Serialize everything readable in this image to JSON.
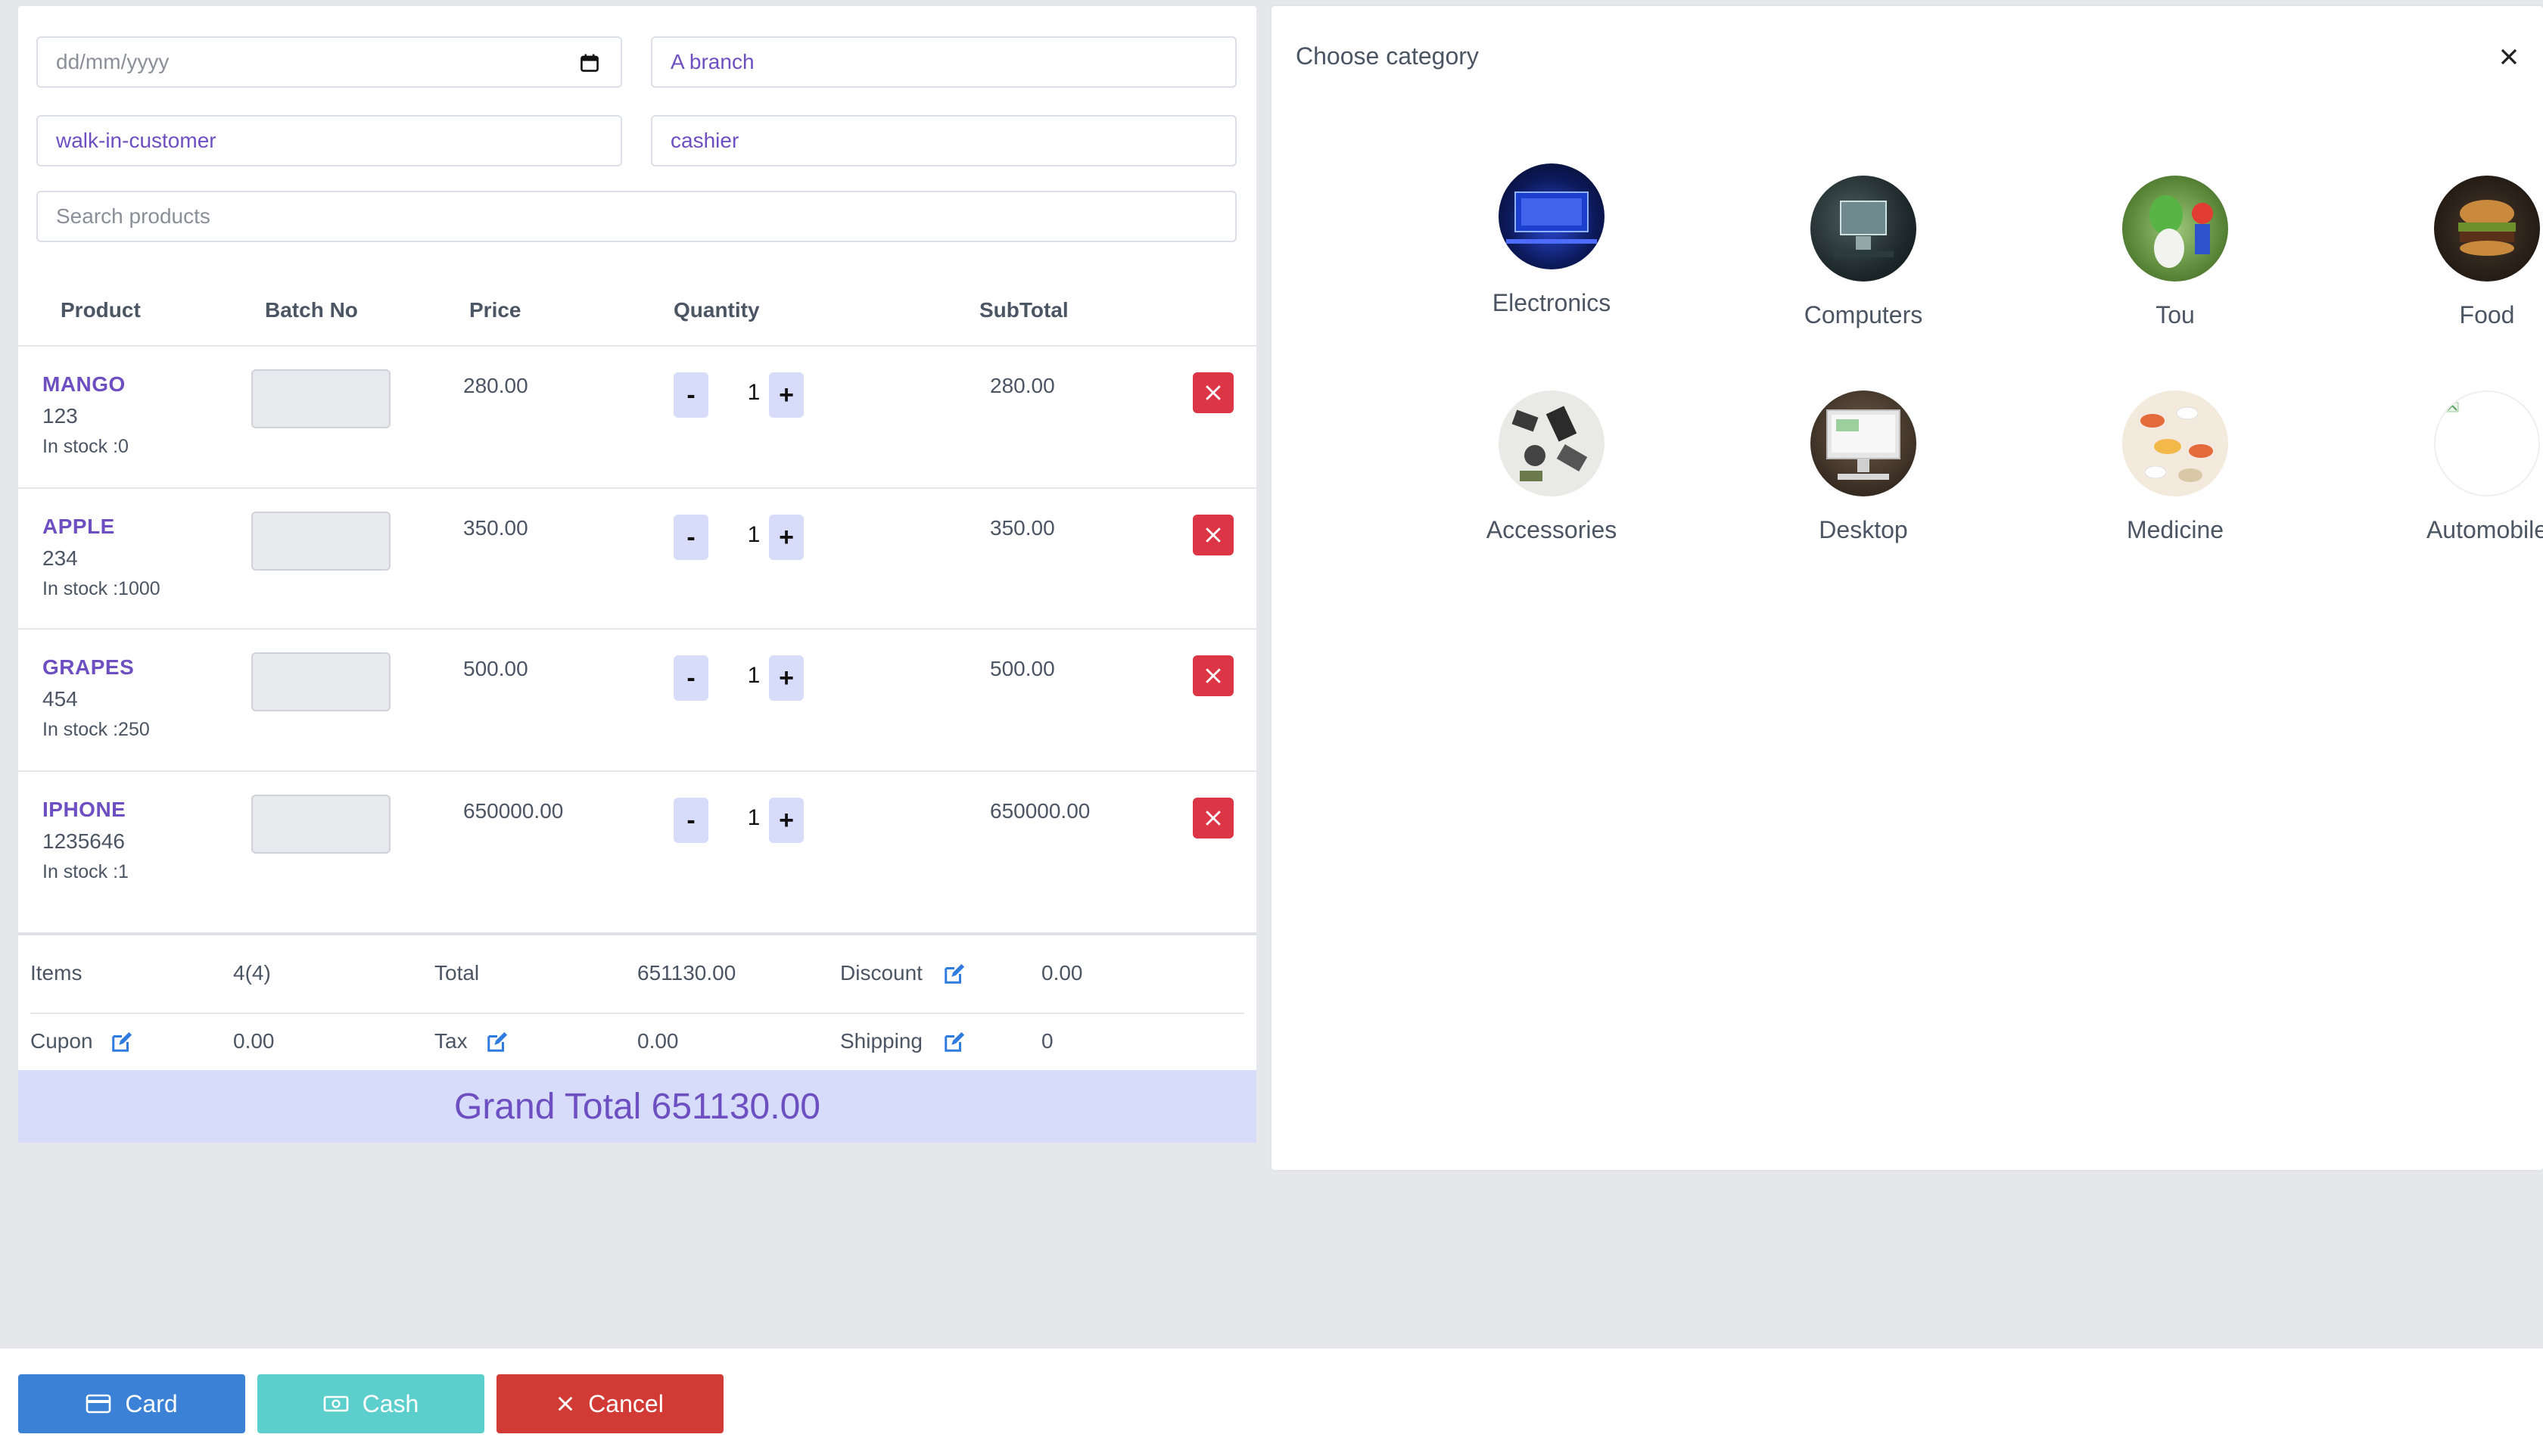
{
  "form": {
    "date_placeholder": "dd/mm/yyyy",
    "branch": "A branch",
    "customer": "walk-in-customer",
    "cashier": "cashier",
    "search_placeholder": "Search products"
  },
  "table": {
    "headers": [
      "Product",
      "Batch No",
      "Price",
      "Quantity",
      "SubTotal"
    ],
    "rows": [
      {
        "name": "MANGO",
        "code": "123",
        "stock": "In stock :0",
        "price": "280.00",
        "qty": "1",
        "subtotal": "280.00"
      },
      {
        "name": "APPLE",
        "code": "234",
        "stock": "In stock :1000",
        "price": "350.00",
        "qty": "1",
        "subtotal": "350.00"
      },
      {
        "name": "GRAPES",
        "code": "454",
        "stock": "In stock :250",
        "price": "500.00",
        "qty": "1",
        "subtotal": "500.00"
      },
      {
        "name": "IPHONE",
        "code": "1235646",
        "stock": "In stock :1",
        "price": "650000.00",
        "qty": "1",
        "subtotal": "650000.00"
      }
    ],
    "minus": "-",
    "plus": "+"
  },
  "summary": {
    "items_label": "Items",
    "items_value": "4(4)",
    "total_label": "Total",
    "total_value": "651130.00",
    "discount_label": "Discount",
    "discount_value": "0.00",
    "cupon_label": "Cupon",
    "cupon_value": "0.00",
    "tax_label": "Tax",
    "tax_value": "0.00",
    "shipping_label": "Shipping",
    "shipping_value": "0",
    "grand_total": "Grand Total 651130.00"
  },
  "category_panel": {
    "title": "Choose category",
    "categories": [
      {
        "label": "Electronics",
        "icon": "electronics-thumbnail"
      },
      {
        "label": "Computers",
        "icon": "computers-thumbnail"
      },
      {
        "label": "Tou",
        "icon": "toys-thumbnail"
      },
      {
        "label": "Food",
        "icon": "food-thumbnail"
      },
      {
        "label": "Accessories",
        "icon": "accessories-thumbnail"
      },
      {
        "label": "Desktop",
        "icon": "desktop-thumbnail"
      },
      {
        "label": "Medicine",
        "icon": "medicine-thumbnail"
      },
      {
        "label": "Automobile",
        "icon": "broken-image-thumbnail"
      }
    ]
  },
  "footer": {
    "card_label": "Card",
    "cash_label": "Cash",
    "cancel_label": "Cancel"
  },
  "colors": {
    "accent_purple": "#6d4fc2",
    "card_button": "#3b82d6",
    "cash_button": "#5ccfcc",
    "cancel_button": "#d23a35",
    "delete_button": "#dc3545",
    "grand_total_bg": "#d7dcfa"
  }
}
